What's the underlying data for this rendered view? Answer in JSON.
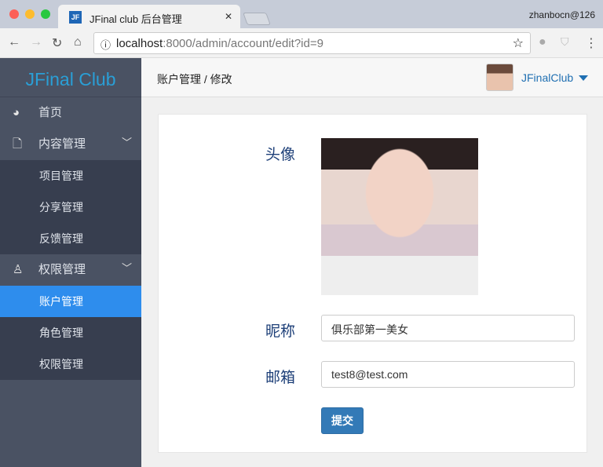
{
  "browser": {
    "tab_title": "JFinal club 后台管理",
    "favicon_text": "JF",
    "profile": "zhanbocn@126",
    "url_host": "localhost",
    "url_rest": ":8000/admin/account/edit?id=9"
  },
  "sidebar": {
    "logo": "JFinal Club",
    "items": [
      {
        "label": "首页"
      },
      {
        "label": "内容管理"
      },
      {
        "label": "项目管理"
      },
      {
        "label": "分享管理"
      },
      {
        "label": "反馈管理"
      },
      {
        "label": "权限管理"
      },
      {
        "label": "账户管理"
      },
      {
        "label": "角色管理"
      },
      {
        "label": "权限管理"
      }
    ]
  },
  "header": {
    "breadcrumb": "账户管理 / 修改",
    "username": "JFinalClub"
  },
  "form": {
    "avatar_label": "头像",
    "nickname_label": "昵称",
    "nickname_value": "俱乐部第一美女",
    "email_label": "邮箱",
    "email_value": "test8@test.com",
    "submit": "提交"
  }
}
